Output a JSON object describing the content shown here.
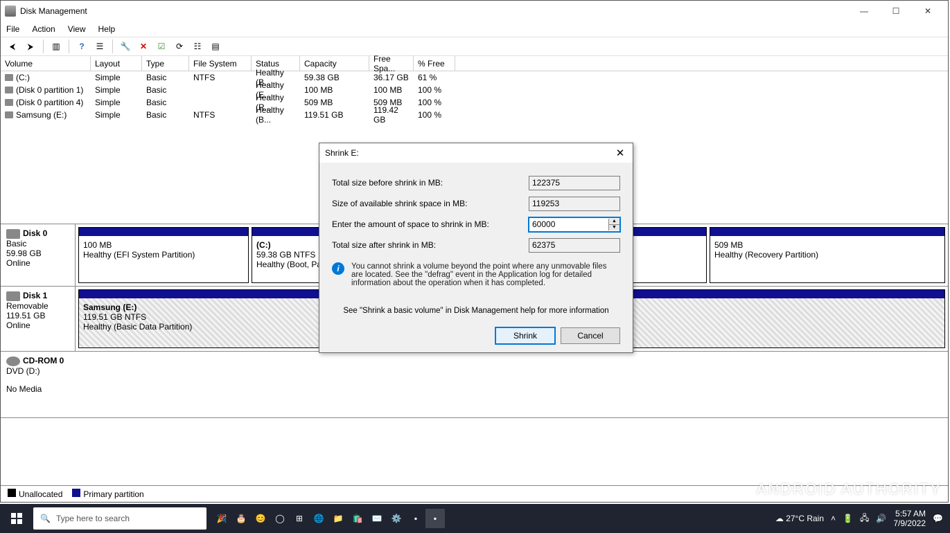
{
  "window": {
    "title": "Disk Management"
  },
  "menu": {
    "file": "File",
    "action": "Action",
    "view": "View",
    "help": "Help"
  },
  "columns": {
    "volume": "Volume",
    "layout": "Layout",
    "type": "Type",
    "fs": "File System",
    "status": "Status",
    "capacity": "Capacity",
    "free": "Free Spa...",
    "pct": "% Free"
  },
  "volumes": [
    {
      "name": "(C:)",
      "layout": "Simple",
      "type": "Basic",
      "fs": "NTFS",
      "status": "Healthy (B...",
      "capacity": "59.38 GB",
      "free": "36.17 GB",
      "pct": "61 %"
    },
    {
      "name": "(Disk 0 partition 1)",
      "layout": "Simple",
      "type": "Basic",
      "fs": "",
      "status": "Healthy (E...",
      "capacity": "100 MB",
      "free": "100 MB",
      "pct": "100 %"
    },
    {
      "name": "(Disk 0 partition 4)",
      "layout": "Simple",
      "type": "Basic",
      "fs": "",
      "status": "Healthy (R...",
      "capacity": "509 MB",
      "free": "509 MB",
      "pct": "100 %"
    },
    {
      "name": "Samsung (E:)",
      "layout": "Simple",
      "type": "Basic",
      "fs": "NTFS",
      "status": "Healthy (B...",
      "capacity": "119.51 GB",
      "free": "119.42 GB",
      "pct": "100 %"
    }
  ],
  "disks": {
    "d0": {
      "name": "Disk 0",
      "type": "Basic",
      "size": "59.98 GB",
      "state": "Online",
      "p1": {
        "size": "100 MB",
        "status": "Healthy (EFI System Partition)"
      },
      "p2": {
        "label": "(C:)",
        "size": "59.38 GB NTFS",
        "status": "Healthy (Boot, Pag"
      },
      "p3": {
        "size": "509 MB",
        "status": "Healthy (Recovery Partition)"
      }
    },
    "d1": {
      "name": "Disk 1",
      "type": "Removable",
      "size": "119.51 GB",
      "state": "Online",
      "p1": {
        "label": "Samsung  (E:)",
        "size": "119.51 GB NTFS",
        "status": "Healthy (Basic Data Partition)"
      }
    },
    "cd": {
      "name": "CD-ROM 0",
      "type": "DVD (D:)",
      "state": "No Media"
    }
  },
  "legend": {
    "unalloc": "Unallocated",
    "primary": "Primary partition"
  },
  "dialog": {
    "title": "Shrink E:",
    "total_before_lbl": "Total size before shrink in MB:",
    "total_before_val": "122375",
    "avail_lbl": "Size of available shrink space in MB:",
    "avail_val": "119253",
    "amount_lbl": "Enter the amount of space to shrink in MB:",
    "amount_val": "60000",
    "after_lbl": "Total size after shrink in MB:",
    "after_val": "62375",
    "info": "You cannot shrink a volume beyond the point where any unmovable files are located. See the \"defrag\" event in the Application log for detailed information about the operation when it has completed.",
    "help": "See \"Shrink a basic volume\" in Disk Management help for more information",
    "shrink_btn": "Shrink",
    "cancel_btn": "Cancel"
  },
  "taskbar": {
    "search_placeholder": "Type here to search",
    "weather": "27°C  Rain",
    "time": "5:57 AM",
    "date": "7/9/2022"
  },
  "watermark": "ANDROID AUTHORITY"
}
